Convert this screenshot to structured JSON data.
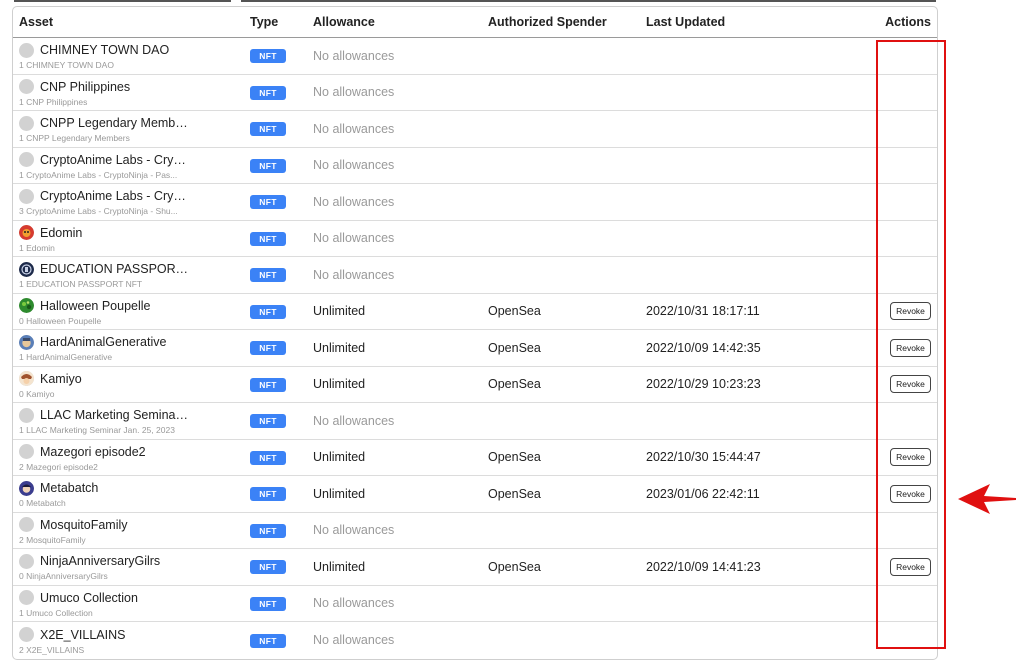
{
  "headers": {
    "asset": "Asset",
    "type": "Type",
    "allowance": "Allowance",
    "spender": "Authorized Spender",
    "updated": "Last Updated",
    "actions": "Actions"
  },
  "rows": [
    {
      "name": "CHIMNEY TOWN DAO",
      "sub": "1 CHIMNEY TOWN DAO",
      "type": "NFT",
      "allowance": "No allowances",
      "spender": "",
      "updated": "",
      "revoke": "",
      "avatar": "placeholder"
    },
    {
      "name": "CNP Philippines",
      "sub": "1 CNP Philippines",
      "type": "NFT",
      "allowance": "No allowances",
      "spender": "",
      "updated": "",
      "revoke": "",
      "avatar": "placeholder"
    },
    {
      "name": "CNPP Legendary Members",
      "sub": "1 CNPP Legendary Members",
      "type": "NFT",
      "allowance": "No allowances",
      "spender": "",
      "updated": "",
      "revoke": "",
      "avatar": "placeholder"
    },
    {
      "name": "CryptoAnime Labs - Crypt...",
      "sub": "1 CryptoAnime Labs - CryptoNinja - Pas...",
      "type": "NFT",
      "allowance": "No allowances",
      "spender": "",
      "updated": "",
      "revoke": "",
      "avatar": "placeholder"
    },
    {
      "name": "CryptoAnime Labs - Crypt...",
      "sub": "3 CryptoAnime Labs - CryptoNinja - Shu...",
      "type": "NFT",
      "allowance": "No allowances",
      "spender": "",
      "updated": "",
      "revoke": "",
      "avatar": "placeholder"
    },
    {
      "name": "Edomin",
      "sub": "1 Edomin",
      "type": "NFT",
      "allowance": "No allowances",
      "spender": "",
      "updated": "",
      "revoke": "",
      "avatar": "edomin"
    },
    {
      "name": "EDUCATION PASSPORT ...",
      "sub": "1 EDUCATION PASSPORT NFT",
      "type": "NFT",
      "allowance": "No allowances",
      "spender": "",
      "updated": "",
      "revoke": "",
      "avatar": "passport"
    },
    {
      "name": "Halloween Poupelle",
      "sub": "0 Halloween Poupelle",
      "type": "NFT",
      "allowance": "Unlimited",
      "spender": "OpenSea",
      "updated": "2022/10/31 18:17:11",
      "revoke": "Revoke",
      "avatar": "halloween"
    },
    {
      "name": "HardAnimalGenerative",
      "sub": "1 HardAnimalGenerative",
      "type": "NFT",
      "allowance": "Unlimited",
      "spender": "OpenSea",
      "updated": "2022/10/09 14:42:35",
      "revoke": "Revoke",
      "avatar": "hardanimal"
    },
    {
      "name": "Kamiyo",
      "sub": "0 Kamiyo",
      "type": "NFT",
      "allowance": "Unlimited",
      "spender": "OpenSea",
      "updated": "2022/10/29 10:23:23",
      "revoke": "Revoke",
      "avatar": "kamiyo"
    },
    {
      "name": "LLAC Marketing Seminar ...",
      "sub": "1 LLAC Marketing Seminar Jan. 25, 2023",
      "type": "NFT",
      "allowance": "No allowances",
      "spender": "",
      "updated": "",
      "revoke": "",
      "avatar": "placeholder"
    },
    {
      "name": "Mazegori episode2",
      "sub": "2 Mazegori episode2",
      "type": "NFT",
      "allowance": "Unlimited",
      "spender": "OpenSea",
      "updated": "2022/10/30 15:44:47",
      "revoke": "Revoke",
      "avatar": "placeholder"
    },
    {
      "name": "Metabatch",
      "sub": "0 Metabatch",
      "type": "NFT",
      "allowance": "Unlimited",
      "spender": "OpenSea",
      "updated": "2023/01/06 22:42:11",
      "revoke": "Revoke",
      "avatar": "metabatch"
    },
    {
      "name": "MosquitoFamily",
      "sub": "2 MosquitoFamily",
      "type": "NFT",
      "allowance": "No allowances",
      "spender": "",
      "updated": "",
      "revoke": "",
      "avatar": "placeholder"
    },
    {
      "name": "NinjaAnniversaryGilrs",
      "sub": "0 NinjaAnniversaryGilrs",
      "type": "NFT",
      "allowance": "Unlimited",
      "spender": "OpenSea",
      "updated": "2022/10/09 14:41:23",
      "revoke": "Revoke",
      "avatar": "placeholder"
    },
    {
      "name": "Umuco Collection",
      "sub": "1 Umuco Collection",
      "type": "NFT",
      "allowance": "No allowances",
      "spender": "",
      "updated": "",
      "revoke": "",
      "avatar": "placeholder"
    },
    {
      "name": "X2E_VILLAINS",
      "sub": "2 X2E_VILLAINS",
      "type": "NFT",
      "allowance": "No allowances",
      "spender": "",
      "updated": "",
      "revoke": "",
      "avatar": "placeholder"
    }
  ],
  "colors": {
    "badge": "#3b82f6",
    "highlight": "#e01010",
    "muted_text": "#9a9a9a"
  },
  "annotations": {
    "highlight_box_target": "actions-column",
    "arrow_icon": "red-arrow-left-icon",
    "arrow_points_to_row": "Metabatch"
  }
}
